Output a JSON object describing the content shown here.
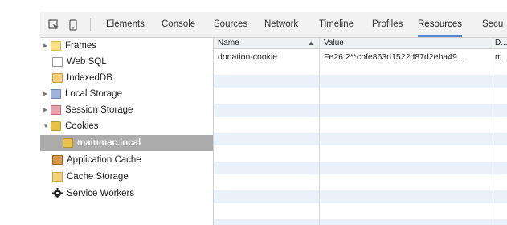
{
  "toolbar": {
    "inspect_icon": "inspect-element-icon",
    "device_icon": "device-mode-icon",
    "tabs": [
      {
        "label": "Elements"
      },
      {
        "label": "Console"
      },
      {
        "label": "Sources"
      },
      {
        "label": "Network"
      },
      {
        "label": "Timeline"
      },
      {
        "label": "Profiles"
      },
      {
        "label": "Resources"
      },
      {
        "label": "Secu"
      }
    ],
    "active_tab": "Resources",
    "accent": "#5a86d8"
  },
  "sidebar": {
    "items": [
      {
        "label": "Frames",
        "icon": "folder-icon",
        "expandable": true
      },
      {
        "label": "Web SQL",
        "icon": "database-icon",
        "expandable": false
      },
      {
        "label": "IndexedDB",
        "icon": "database-icon",
        "expandable": false
      },
      {
        "label": "Local Storage",
        "icon": "storage-grid-icon",
        "expandable": true
      },
      {
        "label": "Session Storage",
        "icon": "storage-grid-icon",
        "expandable": true
      },
      {
        "label": "Cookies",
        "icon": "cookie-icon",
        "expandable": true,
        "expanded": true
      },
      {
        "label": "mainmac.local",
        "icon": "cookie-icon",
        "selected": true
      },
      {
        "label": "Application Cache",
        "icon": "app-cache-icon",
        "expandable": false
      },
      {
        "label": "Cache Storage",
        "icon": "database-icon",
        "expandable": false
      },
      {
        "label": "Service Workers",
        "icon": "gear-icon",
        "expandable": false
      }
    ],
    "selected_bg": "#acacac"
  },
  "table": {
    "columns": [
      {
        "label": "Name",
        "sort": "▲"
      },
      {
        "label": "Value"
      },
      {
        "label": "D..."
      }
    ],
    "rows": [
      {
        "name": "donation-cookie",
        "value": "Fe26.2**cbfe863d1522d87d2eba49...",
        "domain": "m..."
      }
    ],
    "stripe_color": "#eaf1fb"
  }
}
